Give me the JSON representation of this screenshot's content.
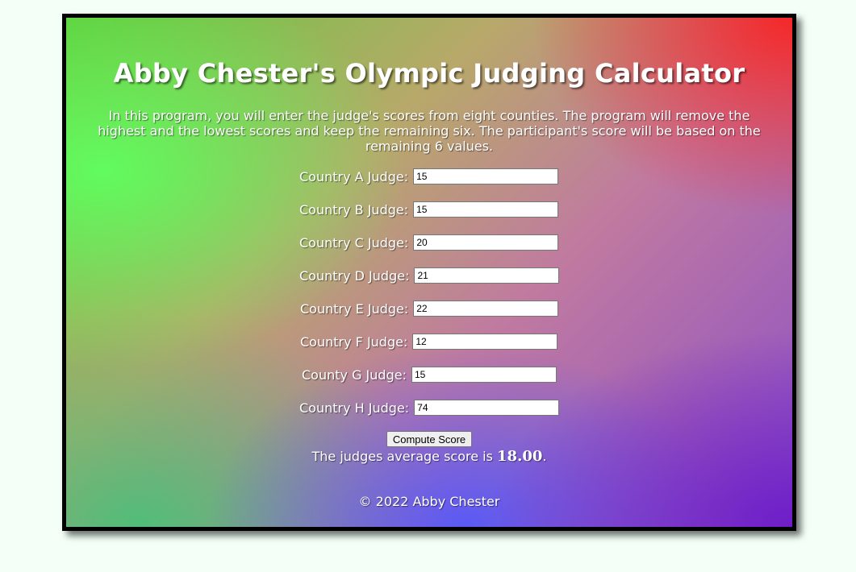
{
  "page": {
    "title": "Abby Chester's Olympic Judging Calculator",
    "intro": "In this program, you will enter the judge's scores from eight counties. The program will remove the highest and the lowest scores and keep the remaining six. The participant's score will be based on the remaining 6 values."
  },
  "judges": [
    {
      "label": "Country A Judge:",
      "value": "15"
    },
    {
      "label": "Country B Judge:",
      "value": "15"
    },
    {
      "label": "Country C Judge:",
      "value": "20"
    },
    {
      "label": "Country D Judge:",
      "value": "21"
    },
    {
      "label": "Country E Judge:",
      "value": "22"
    },
    {
      "label": "Country F Judge:",
      "value": "12"
    },
    {
      "label": "County G Judge:",
      "value": "15"
    },
    {
      "label": "Country H Judge:",
      "value": "74"
    }
  ],
  "actions": {
    "compute_label": "Compute Score"
  },
  "result": {
    "prefix": "The judges average score is",
    "score": "18.00",
    "suffix": "."
  },
  "footer": {
    "text": "© 2022 Abby Chester"
  },
  "colors": {
    "page_background": "#f3fff7",
    "frame_border": "#000000",
    "text": "#ffffff"
  }
}
